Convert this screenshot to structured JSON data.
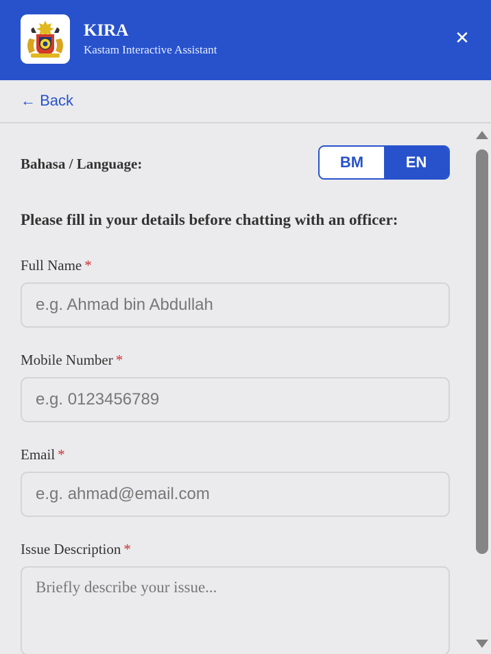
{
  "header": {
    "title": "KIRA",
    "subtitle": "Kastam Interactive Assistant",
    "close_label": "✕"
  },
  "nav": {
    "back_label": "← Back"
  },
  "language": {
    "label": "Bahasa / Language:",
    "options": [
      "BM",
      "EN"
    ],
    "selected": "EN"
  },
  "form": {
    "instructions": "Please fill in your details before chatting with an officer:",
    "required_mark": "*",
    "full_name": {
      "label": "Full Name",
      "placeholder": "e.g. Ahmad bin Abdullah",
      "value": ""
    },
    "mobile": {
      "label": "Mobile Number",
      "placeholder": "e.g. 0123456789",
      "value": ""
    },
    "email": {
      "label": "Email",
      "placeholder": "e.g. ahmad@email.com",
      "value": ""
    },
    "issue": {
      "label": "Issue Description",
      "placeholder": "Briefly describe your issue...",
      "value": ""
    }
  },
  "colors": {
    "primary": "#2752cc",
    "background": "#ebebed",
    "required": "#d03030"
  }
}
